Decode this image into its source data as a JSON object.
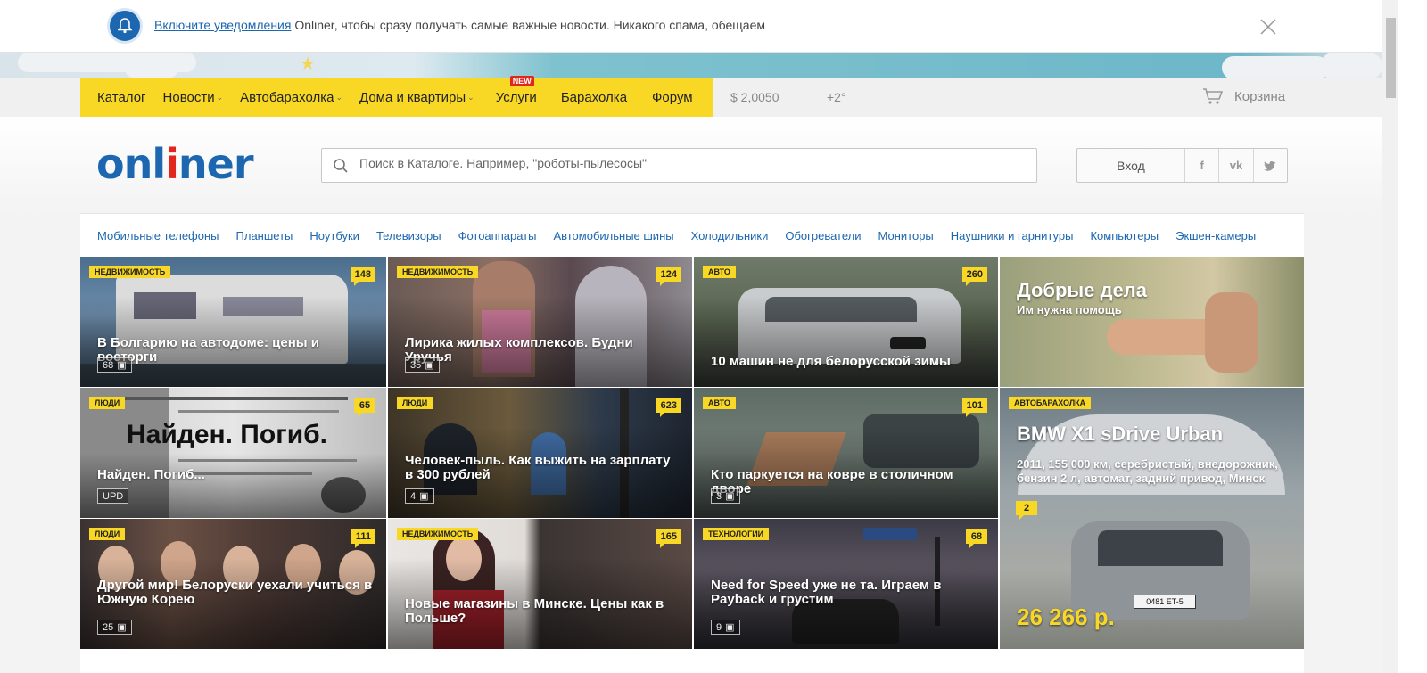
{
  "notification": {
    "link": "Включите уведомления",
    "text": " Onliner, чтобы сразу получать самые важные новости. Никакого спама, обещаем"
  },
  "topnav": {
    "items": [
      {
        "label": "Каталог"
      },
      {
        "label": "Новости",
        "caret": "⌄"
      },
      {
        "label": "Автобарахолка",
        "caret": "⌄"
      },
      {
        "label": "Дома и квартиры",
        "caret": "⌄"
      },
      {
        "label": "Услуги",
        "badge": "NEW"
      },
      {
        "label": "Барахолка"
      },
      {
        "label": "Форум"
      }
    ],
    "rate": "$ 2,0050",
    "temperature": "+2°",
    "cart": "Корзина"
  },
  "header": {
    "logo_left": "onl",
    "logo_red": "i",
    "logo_right": "ner",
    "search_placeholder": "Поиск в Каталоге. Например, \"роботы-пылесосы\"",
    "login": "Вход",
    "social": [
      "f",
      "vk",
      "t"
    ]
  },
  "catalog": [
    "Мобильные телефоны",
    "Планшеты",
    "Ноутбуки",
    "Телевизоры",
    "Фотоаппараты",
    "Автомобильные шины",
    "Холодильники",
    "Обогреватели",
    "Мониторы",
    "Наушники и гарнитуры",
    "Компьютеры",
    "Экшен-камеры"
  ],
  "tiles": [
    {
      "tag": "недвижимость",
      "count": "148",
      "title": "В Болгарию на автодоме: цены и восторги",
      "pics": "68"
    },
    {
      "tag": "недвижимость",
      "count": "124",
      "title": "Лирика жилых комплексов. Будни Уручья",
      "pics": "35"
    },
    {
      "tag": "авто",
      "count": "260",
      "title": "10 машин не для белорусской зимы",
      "pics": ""
    },
    {
      "tag": "",
      "count": "",
      "title": "Добрые дела",
      "subtitle": "Им нужна помощь",
      "pics": ""
    },
    {
      "tag": "люди",
      "count": "65",
      "title": "Найден. Погиб...",
      "pics": "UPD",
      "overlay": "Найден. Погиб."
    },
    {
      "tag": "люди",
      "count": "623",
      "title": "Человек-пыль. Как выжить на зарплату в 300 рублей",
      "pics": "4"
    },
    {
      "tag": "авто",
      "count": "101",
      "title": "Кто паркуется на ковре в столичном дворе",
      "pics": "3"
    },
    {
      "tag": "автобарахолка",
      "count": "2",
      "title": "BMW X1 sDrive Urban",
      "subtitle": "2011, 155 000 км, серебристый, внедорожник, бензин 2 л, автомат, задний привод, Минск",
      "price": "26 266 р.",
      "plate": "0481 ET-5"
    },
    {
      "tag": "люди",
      "count": "111",
      "title": "Другой мир! Белоруски уехали учиться в Южную Корею",
      "pics": "25"
    },
    {
      "tag": "недвижимость",
      "count": "165",
      "title": "Новые магазины в Минске. Цены как в Польше?",
      "pics": ""
    },
    {
      "tag": "технологии",
      "count": "68",
      "title": "Need for Speed уже не та. Играем в Payback и грустим",
      "pics": "9"
    }
  ],
  "colors": {
    "accent": "#f8d825",
    "brand": "#1c67b0",
    "logo_red": "#e1261c"
  }
}
